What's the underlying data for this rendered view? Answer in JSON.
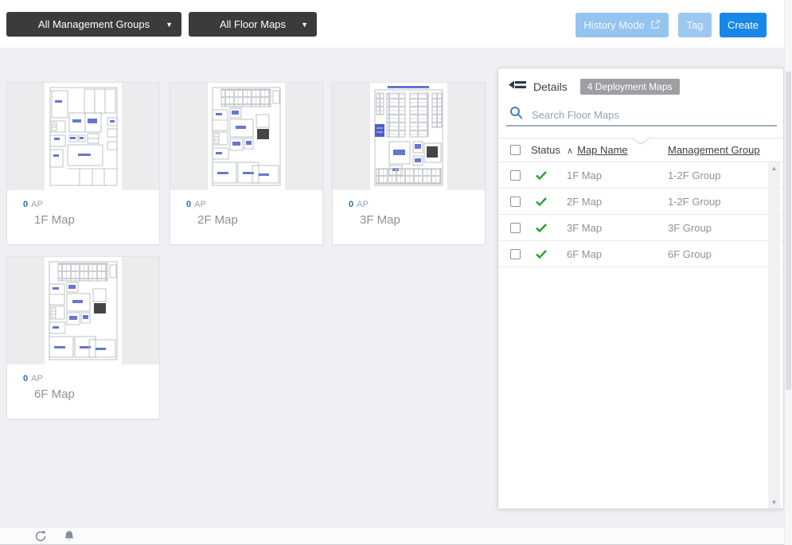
{
  "topbar": {
    "management_groups_dropdown": "All Management Groups",
    "floor_maps_dropdown": "All Floor Maps",
    "history_mode_label": "History Mode",
    "tag_label": "Tag",
    "create_label": "Create"
  },
  "cards": [
    {
      "ap_count": "0",
      "ap_unit": "AP",
      "name": "1F Map"
    },
    {
      "ap_count": "0",
      "ap_unit": "AP",
      "name": "2F Map"
    },
    {
      "ap_count": "0",
      "ap_unit": "AP",
      "name": "3F Map"
    },
    {
      "ap_count": "0",
      "ap_unit": "AP",
      "name": "6F Map"
    }
  ],
  "details_panel": {
    "title": "Details",
    "badge": "4 Deployment Maps",
    "search_placeholder": "Search Floor Maps",
    "sort_indicator": "∧",
    "columns": {
      "status": "Status",
      "map_name": "Map Name",
      "management_group": "Management Group"
    },
    "rows": [
      {
        "status": "ok",
        "map_name": "1F Map",
        "management_group": "1-2F Group"
      },
      {
        "status": "ok",
        "map_name": "2F Map",
        "management_group": "1-2F Group"
      },
      {
        "status": "ok",
        "map_name": "3F Map",
        "management_group": "3F Group"
      },
      {
        "status": "ok",
        "map_name": "6F Map",
        "management_group": "6F Group"
      }
    ]
  },
  "icons": {
    "dropdown_caret": "▼",
    "scroll_up": "▲",
    "scroll_down": "▼",
    "history_mode_icon": "external-link",
    "details_header_icon": "collapse-left-arrow",
    "search_icon": "magnifier",
    "status_ok_icon": "green-check",
    "footer_icons": [
      "refresh",
      "bell"
    ]
  },
  "colors": {
    "primary_button": "#1787e9",
    "secondary_button": "#95c4ef",
    "dark_dropdown": "#3b3b3b",
    "status_ok_green": "#2f9e2f",
    "badge_gray": "#9d9fa2",
    "ap_count_blue": "#2c6cb0"
  }
}
